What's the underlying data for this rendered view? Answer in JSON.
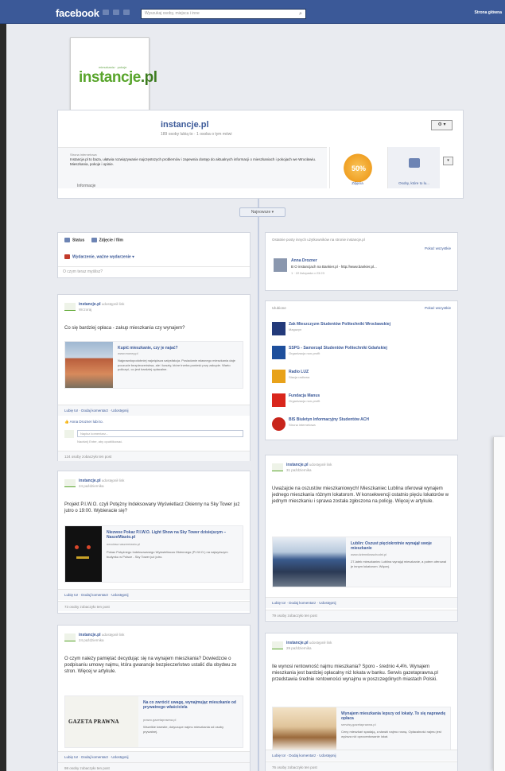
{
  "topbar": {
    "logo": "facebook",
    "search_placeholder": "Wyszukaj osoby, miejsca i inne",
    "home_link": "Strona główna"
  },
  "page": {
    "logo_small": "mieszkania · pokoje",
    "logo_main": "instancje",
    "logo_suffix": ".pl",
    "name": "instancje.pl",
    "likes_line": "189 osoby lubią to · 1 osoba o tym mówi",
    "gear_label": "⚙ ▾",
    "about_title": "Strona internetowa",
    "about_text": "Instancje.pl to baza, ułatwia rozwiązywanie najczęstszych problemów i zapewnia dostęp do aktualnych informacji o mieszkaniach i pokojach we Wrocławiu. Mieszkania, pokoje i opinie.",
    "about_link": "Informacje",
    "thumbs": [
      {
        "label": "Zdjęcia",
        "promo": "50%"
      },
      {
        "label": "Osoby, które to lu..."
      }
    ],
    "thumb_arrow": "▾",
    "recent_pill": "Najnowsze ▾"
  },
  "composer": {
    "tab_status": "Status",
    "tab_photo": "Zdjęcie / film",
    "milestone": "Wydarzenie, ważne wydarzenie ▾",
    "placeholder": "O czym teraz myślisz?"
  },
  "left_posts": [
    {
      "poster": "instancje.pl",
      "poster_action": "udostępnił link",
      "date": "Wczoraj",
      "text": "Co się bardziej opłaca - zakup mieszkania czy wynajem?",
      "link_title": "Kupić mieszkanie, czy je najać?",
      "link_domain": "www.money.pl",
      "link_desc": "Najprawdopodobniej największa satysfakcja. Posiadanie własnego mieszkania daje poczucie bezpieczeństwa, ale i koszty, które trzeba ponieść przy zakupie. Warto policzyć, co jest bardziej opłacalne.",
      "actions": "Lubię to! · Dodaj komentarz · Udostępnij",
      "likers": "Anna Drozner lubi to.",
      "comment_placeholder": "Napisz komentarz...",
      "comment_hint": "Naciśnij Enter, aby opublikować.",
      "footer": "124 osoby zobaczyło ten post"
    },
    {
      "poster": "instancje.pl",
      "poster_action": "udostępnił link",
      "date": "24 października",
      "text": "Projekt P.I.W.O. czyli Potężny Indeksowany Wyświetlacz Okienny na Sky Tower już jutro o 19:00. Wybieracie się?",
      "link_title": "Niezwoe Pokaz P.I.W.O. Light Show na Sky Tower dzisiejszym – NaszeMiasto.pl",
      "link_domain": "wroclaw.naszemiasto.pl",
      "link_desc": "Pokaz Potężnego Indeksowanego Wyświetlacza Okiennego (P.I.W.O.) na najwyższym budynku w Polsce - Sky Tower już jutro.",
      "actions": "Lubię to! · Dodaj komentarz · Udostępnij",
      "footer": "73 osoby zobaczyło ten post"
    },
    {
      "poster": "instancje.pl",
      "poster_action": "udostępnił link",
      "date": "24 października",
      "text": "O czym należy pamiętać decydując się na wynajem mieszkania? Dowiedzcie o podpisaniu umowy najmu, która gwarancje bezpieczeństwo ustalić dla obydwu ze stron. Więcej w artykule.",
      "link_title": "Na co zwrócić uwagę, wynajmując mieszkanie od prywatnego właściciela",
      "link_domain": "prawo.gazetaprawna.pl",
      "link_desc": "Wszelkie kwestie, dotyczące najmu mieszkania od osoby prywatnej.",
      "logo_text": "GAZETA PRAWNA",
      "actions": "Lubię to! · Dodaj komentarz · Udostępnij",
      "footer": "98 osoby zobaczyło ten post"
    }
  ],
  "right_recent": {
    "head": "Ostatnie posty innych użytkowników na stronie instancje.pl",
    "more": "Pokaż wszystkie",
    "author": "Anna Drozner",
    "snippet": "B O instancjach na Bankier.pl - http://www.bankier.pl...",
    "meta": "1 · 22 listopada o 23:23"
  },
  "right_liked": {
    "head": "Ulubione",
    "more": "Pokaż wszystkie",
    "items": [
      {
        "name": "Zak Mieszczyzm Studentów Politechniki Wrocławskiej",
        "cat": "Magazyn",
        "color": "#233a7a"
      },
      {
        "name": "SSPG - Samorząd Studentów Politechniki Gdańskiej",
        "cat": "Organizacja non-profit",
        "color": "#1e4f9c"
      },
      {
        "name": "Radio LUZ",
        "cat": "Stacja radiowa",
        "color": "#e8a21a"
      },
      {
        "name": "Fundacja Manus",
        "cat": "Organizacja non-profit",
        "color": "#d9261c"
      },
      {
        "name": "BIS Biuletyn Informacyjny Studentów ACH",
        "cat": "Strona internetowa",
        "color": "#c8251b"
      }
    ]
  },
  "right_posts": [
    {
      "poster": "instancje.pl",
      "poster_action": "udostępnił link",
      "date": "31 października",
      "text": "Uważajcie na oszustów mieszkaniowych! Mieszkaniec Lublina oferował wynajem jednego mieszkania różnym lokatorom. W konsekwencji ostatnio pięciu lokatorów w jednym mieszkaniu i sprawa została zgłoszona na policję. Więcej w artykule.",
      "link_title": "Lublin: Oszust pięciokrotnie wynajął swoje mieszkanie",
      "link_domain": "www.dziennikwschodni.pl",
      "link_desc": "27-latek mieszkaniec Lublina wynajął mieszkanie, a potem oferował je innym lokatorom. Więcej.",
      "actions": "Lubię to! · Dodaj komentarz · Udostępnij",
      "footer": "79 osoby zobaczyło ten post"
    },
    {
      "poster": "instancje.pl",
      "poster_action": "udostępnił link",
      "date": "29 października",
      "text": "Ile wynosi rentowność najmu mieszkania? Sporo - średnio 4,4%. Wynajem mieszkania jest bardziej opłacalny niż lokata w banku. Serwis gazetaprawna.pl przedstawia średnie rentowności wynajmu w poszczególnych miastach Polski.",
      "link_title": "Wynajem mieszkania lepszy od lokaty. To się naprawdę opłaca",
      "link_domain": "serwisy.gazetaprawna.pl",
      "link_desc": "Ceny mieszkań spadają, a stawki najmu rosną. Opłacalność najmu jest wyższa niż oprocentowanie lokat.",
      "actions": "Lubię to! · Dodaj komentarz · Udostępnij",
      "footer": "76 osoby zobaczyło ten post"
    }
  ],
  "colors": {
    "fb_blue": "#3b5998",
    "brand_green": "#59a52c",
    "page_bg": "#e9ebf0"
  }
}
